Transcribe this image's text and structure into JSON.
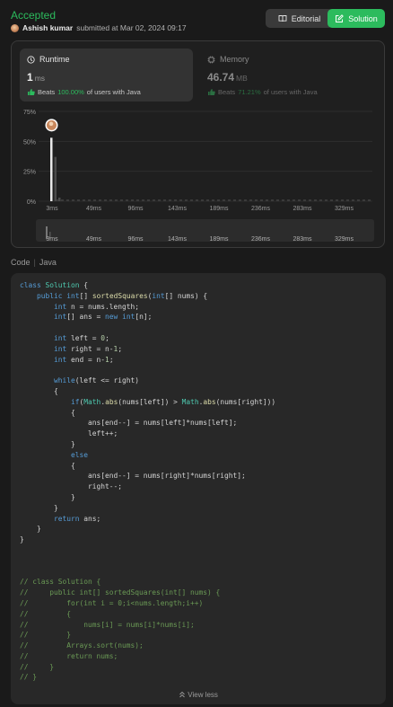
{
  "header": {
    "status": "Accepted",
    "author": "Ashish kumar",
    "submitted_text": "submitted at Mar 02, 2024 09:17",
    "editorial_label": "Editorial",
    "solution_label": "Solution"
  },
  "runtime": {
    "label": "Runtime",
    "value": "1",
    "unit": "ms",
    "beats_label": "Beats",
    "beats_pct": "100.00%",
    "beats_suffix": "of users with Java"
  },
  "memory": {
    "label": "Memory",
    "value": "46.74",
    "unit": "MB",
    "beats_label": "Beats",
    "beats_pct": "71.21%",
    "beats_suffix": "of users with Java"
  },
  "chart_data": {
    "type": "bar",
    "y_tick_labels": [
      "75%",
      "50%",
      "25%",
      "0%"
    ],
    "ylim": [
      0,
      75
    ],
    "x_tick_labels": [
      "3ms",
      "49ms",
      "96ms",
      "143ms",
      "189ms",
      "236ms",
      "283ms",
      "329ms"
    ],
    "grid": true,
    "highlighted": {
      "x": "1ms",
      "y_percent": 53
    },
    "bars": [
      {
        "x": "1ms",
        "y_percent": 53
      },
      {
        "x": "2ms",
        "y_percent": 37
      },
      {
        "x": "3ms",
        "y_percent": 3
      }
    ],
    "brush_tick_labels": [
      "3ms",
      "49ms",
      "96ms",
      "143ms",
      "189ms",
      "236ms",
      "283ms",
      "329ms"
    ]
  },
  "code": {
    "label": "Code",
    "language": "Java",
    "view_less_label": "View less"
  },
  "colors": {
    "accent": "#2cbb5d",
    "background": "#1a1a1a",
    "panel": "#282828"
  }
}
